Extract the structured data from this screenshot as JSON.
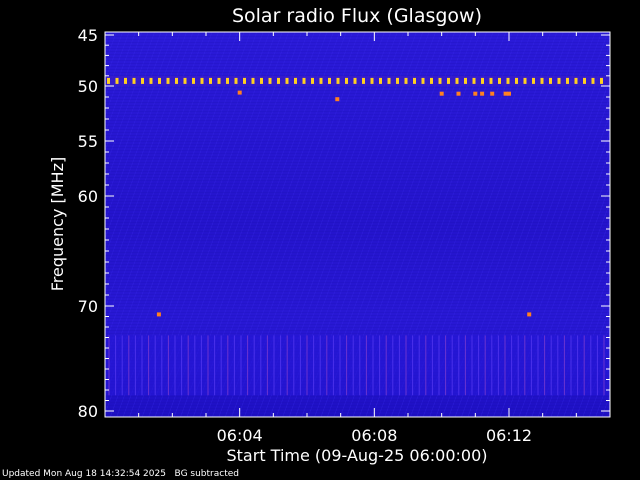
{
  "chart_data": {
    "type": "heatmap",
    "title": "Solar radio Flux (Glasgow)",
    "xlabel": "Start Time (09-Aug-25 06:00:00)",
    "ylabel": "Frequency [MHz]",
    "x_unit": "minutes after 06:00",
    "xlim": [
      0.0,
      15.0
    ],
    "x_ticks": [
      {
        "value": 4,
        "label": "06:04"
      },
      {
        "value": 8,
        "label": "06:08"
      },
      {
        "value": 12,
        "label": "06:12"
      }
    ],
    "ylim": [
      45,
      80
    ],
    "y_reversed": true,
    "y_ticks": [
      {
        "value": 45,
        "label": "45"
      },
      {
        "value": 50,
        "label": "50"
      },
      {
        "value": 55,
        "label": "55"
      },
      {
        "value": 60,
        "label": "60"
      },
      {
        "value": 70,
        "label": "70"
      },
      {
        "value": 80,
        "label": "80"
      }
    ],
    "colors": {
      "background_low": "#1a10c8",
      "background_mid": "#2c1ce0",
      "interference": "#ffd020",
      "hot": "#ff8020"
    },
    "interference_line_mhz": 49.5,
    "bright_spots": [
      {
        "time": 6.9,
        "freq": 51.2
      },
      {
        "time": 10.0,
        "freq": 50.7
      },
      {
        "time": 10.5,
        "freq": 50.7
      },
      {
        "time": 11.0,
        "freq": 50.7
      },
      {
        "time": 11.2,
        "freq": 50.7
      },
      {
        "time": 11.5,
        "freq": 50.7
      },
      {
        "time": 11.9,
        "freq": 50.7
      },
      {
        "time": 12.0,
        "freq": 50.7
      },
      {
        "time": 1.6,
        "freq": 70.8
      },
      {
        "time": 12.6,
        "freq": 70.8
      },
      {
        "time": 4.0,
        "freq": 50.6
      }
    ]
  },
  "footer": {
    "updated": "Updated Mon Aug 18 14:32:54 2025",
    "mode": "BG subtracted"
  }
}
